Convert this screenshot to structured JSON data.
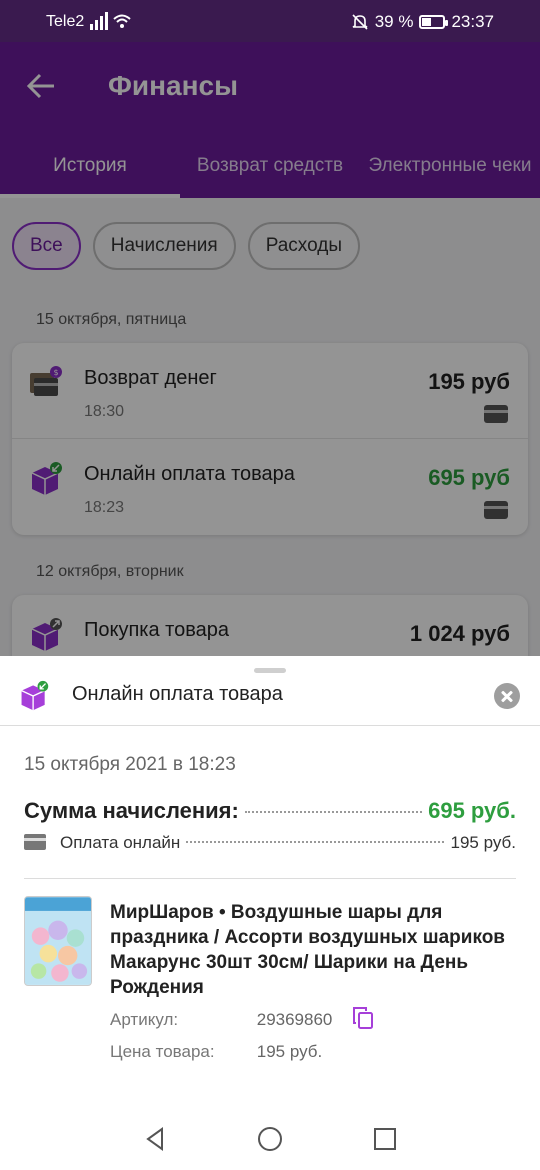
{
  "status_bar": {
    "carrier": "Tele2",
    "battery_text": "39 %",
    "battery_level": 0.39,
    "time": "23:37",
    "icons": [
      "signal-icon",
      "wifi-icon",
      "mute-icon",
      "battery-icon"
    ]
  },
  "header": {
    "title": "Финансы",
    "back_icon": "arrow-left-icon"
  },
  "tabs": [
    {
      "label": "История",
      "active": true
    },
    {
      "label": "Возврат средств",
      "active": false
    },
    {
      "label": "Электронные чеки",
      "active": false
    }
  ],
  "filters": [
    {
      "label": "Все",
      "active": true
    },
    {
      "label": "Начисления",
      "active": false
    },
    {
      "label": "Расходы",
      "active": false
    }
  ],
  "groups": [
    {
      "date": "15 октября, пятница",
      "items": [
        {
          "title": "Возврат денег",
          "time": "18:30",
          "amount": "195 руб",
          "icon": "wallet-refund-icon"
        },
        {
          "title": "Онлайн оплата товара",
          "time": "18:23",
          "amount": "695 руб",
          "icon": "box-incoming-icon"
        }
      ]
    },
    {
      "date": "12 октября, вторник",
      "items": [
        {
          "title": "Покупка товара",
          "time": "",
          "amount": "1 024 руб",
          "icon": "box-outgoing-icon"
        }
      ]
    }
  ],
  "sheet": {
    "title": "Онлайн оплата товара",
    "date": "15 октября 2021 в 18:23",
    "sum_label": "Сумма начисления:",
    "sum_value": "695 руб.",
    "payment_label": "Оплата онлайн",
    "payment_value": "195 руб.",
    "product": {
      "name": "МирШаров • Воздушные шары для праздника / Ассорти воздушных шариков Макарунс 30шт 30см/ Шарики на День Рождения",
      "article_label": "Артикул:",
      "article": "29369860",
      "price_label": "Цена товара:",
      "price": "195 руб."
    }
  },
  "colors": {
    "primary": "#6b1c9c",
    "status_bar": "#3a1a4f",
    "accent_green": "#2e9e3f"
  }
}
